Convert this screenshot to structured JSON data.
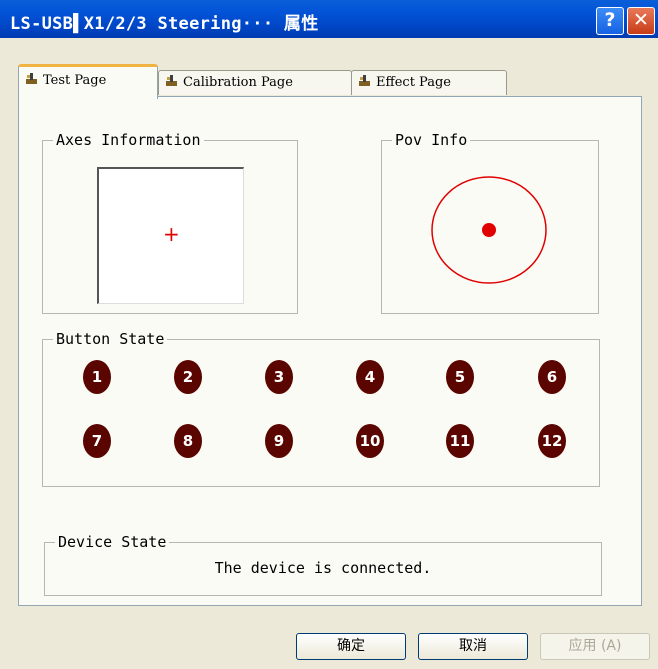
{
  "window": {
    "title": "LS-USB▌X1/2/3 Steering··· 属性",
    "help_label": "?",
    "close_label": "✕"
  },
  "tabs": [
    {
      "label": "Test Page",
      "active": true
    },
    {
      "label": "Calibration Page",
      "active": false
    },
    {
      "label": "Effect Page",
      "active": false
    }
  ],
  "axes": {
    "title": "Axes Information",
    "crosshair": "+"
  },
  "pov": {
    "title": "Pov Info"
  },
  "buttons": {
    "title": "Button State",
    "items": [
      "1",
      "2",
      "3",
      "4",
      "5",
      "6",
      "7",
      "8",
      "9",
      "10",
      "11",
      "12"
    ]
  },
  "device": {
    "title": "Device State",
    "status": "The device is connected."
  },
  "footer": {
    "ok": "确定",
    "cancel": "取消",
    "apply": "应用 (A)"
  },
  "colors": {
    "indicator_red": "#e00000",
    "button_dark": "#5a0500",
    "title_blue": "#0054e3"
  }
}
